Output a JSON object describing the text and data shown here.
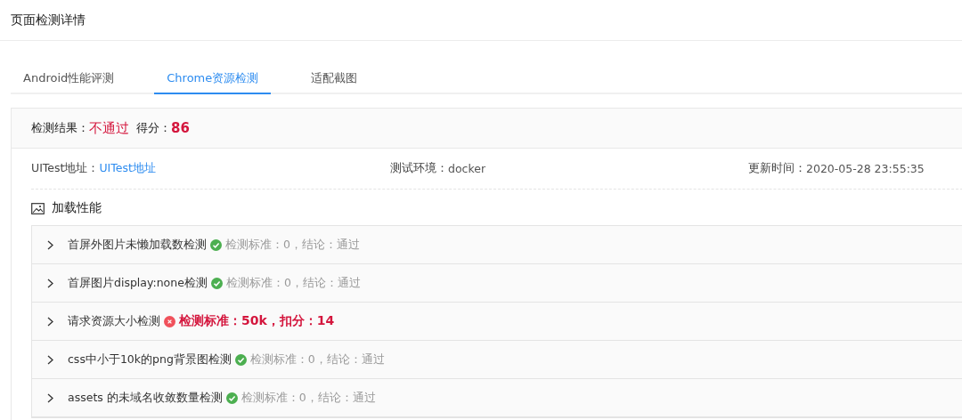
{
  "page_title": "页面检测详情",
  "tabs": [
    {
      "label": "Android性能评测",
      "selected": false
    },
    {
      "label": "Chrome资源检测",
      "selected": true
    },
    {
      "label": "适配截图",
      "selected": false
    }
  ],
  "result": {
    "label": "检测结果：",
    "status": "不通过",
    "score_label": "得分：",
    "score": "86"
  },
  "info": [
    {
      "label": "UITest地址：",
      "value": "UITest地址",
      "kind": "link"
    },
    {
      "label": "测试环境：",
      "value": "docker",
      "kind": "text"
    },
    {
      "label": "更新时间：",
      "value": "2020-05-28 23:55:35",
      "kind": "text"
    }
  ],
  "section_title": "加载性能",
  "checks": [
    {
      "name": "首屏外图片未懒加载数检测",
      "kind": "pass",
      "detail": "检测标准：0，结论：通过"
    },
    {
      "name": "首屏图片display:none检测",
      "kind": "pass",
      "detail": "检测标准：0，结论：通过"
    },
    {
      "name": "请求资源大小检测",
      "kind": "fail",
      "detail": "检测标准：50k，扣分：14"
    },
    {
      "name": "css中小于10k的png背景图检测",
      "kind": "pass",
      "detail": "检测标准：0，结论：通过"
    },
    {
      "name": "assets 的未域名收敛数量检测",
      "kind": "pass",
      "detail": "检测标准：0，结论：通过"
    }
  ]
}
